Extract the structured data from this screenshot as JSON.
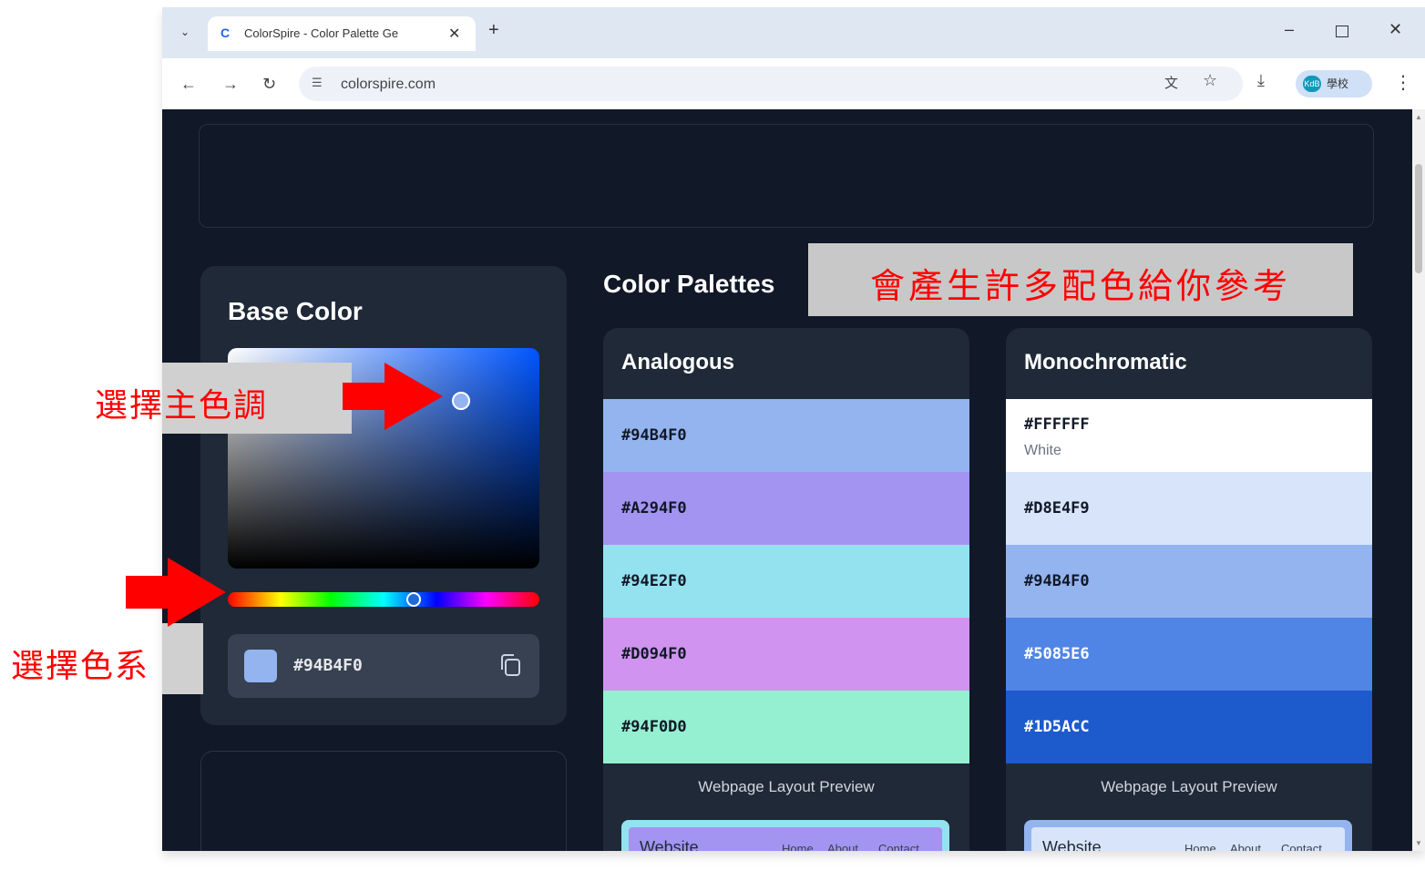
{
  "browser": {
    "tab_title": "ColorSpire - Color Palette Ge",
    "tab_favicon": "C",
    "url": "colorspire.com",
    "profile_name": "學校",
    "avatar_text": "KdB"
  },
  "sidebar": {
    "base_title": "Base Color",
    "hex_value": "#94B4F0",
    "selected_color": "#94B4F0"
  },
  "palettes": {
    "title": "Color Palettes",
    "analogous": {
      "title": "Analogous",
      "colors": [
        {
          "hex": "#94B4F0"
        },
        {
          "hex": "#A294F0"
        },
        {
          "hex": "#94E2F0"
        },
        {
          "hex": "#D094F0"
        },
        {
          "hex": "#94F0D0"
        }
      ],
      "preview_title": "Webpage Layout Preview",
      "preview_brand": "Website",
      "preview_links": [
        "Home",
        "About",
        "Contact"
      ]
    },
    "monochromatic": {
      "title": "Monochromatic",
      "colors": [
        {
          "hex": "#FFFFFF",
          "name": "White"
        },
        {
          "hex": "#D8E4F9"
        },
        {
          "hex": "#94B4F0"
        },
        {
          "hex": "#5085E6"
        },
        {
          "hex": "#1D5ACC"
        }
      ],
      "preview_title": "Webpage Layout Preview",
      "preview_brand": "Website",
      "preview_links": [
        "Home",
        "About",
        "Contact"
      ]
    }
  },
  "annotations": {
    "palettes_note": "會產生許多配色給你參考",
    "main_hue_note": "選擇主色調",
    "color_family_note": "選擇色系"
  }
}
